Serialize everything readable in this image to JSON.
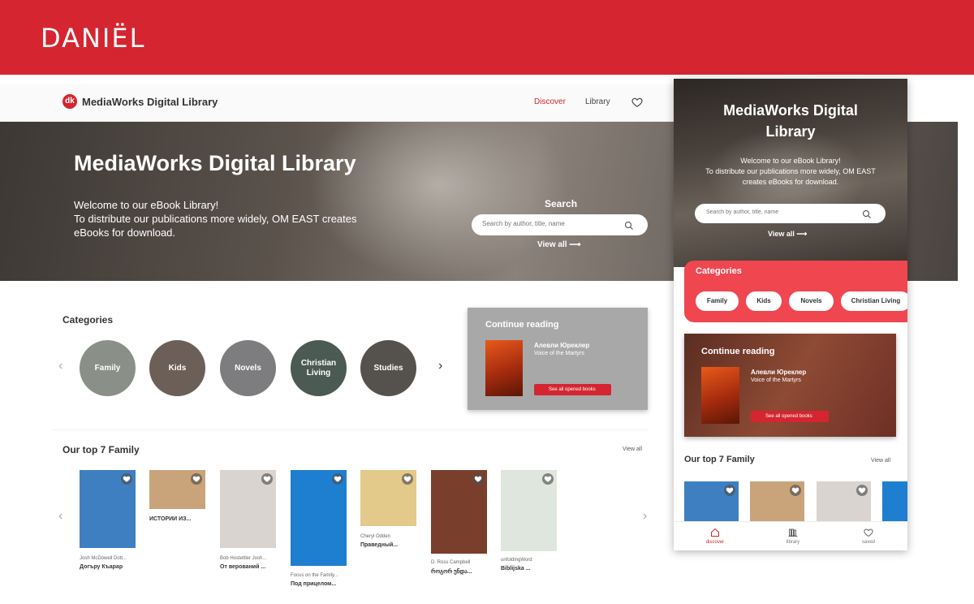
{
  "brand": {
    "name": "DANIËL"
  },
  "desktop": {
    "nav": {
      "logo_text": "MediaWorks Digital Library",
      "links": [
        {
          "label": "Discover",
          "active": true
        },
        {
          "label": "Library",
          "active": false
        }
      ]
    },
    "hero": {
      "title": "MediaWorks Digital Library",
      "line1": "Welcome to our eBook Library!",
      "line2": "To distribute our publications more widely, OM EAST creates eBooks for download.",
      "search_label": "Search",
      "search_placeholder": "Search by author, title, name",
      "view_all": "View all"
    },
    "categories": {
      "title": "Categories",
      "items": [
        {
          "label": "Family",
          "color": "#8a8f88"
        },
        {
          "label": "Kids",
          "color": "#6b5f58"
        },
        {
          "label": "Novels",
          "color": "#7d7d80"
        },
        {
          "label": "Christian Living",
          "color": "#4c5a54"
        },
        {
          "label": "Studies",
          "color": "#55524e"
        }
      ]
    },
    "continue_reading": {
      "title": "Continue reading",
      "book_title": "Алевли Юреклер",
      "book_subtitle": "Voice of the Martyrs",
      "button": "See all opened books"
    },
    "top": {
      "title": "Our top 7 Family",
      "view_all": "View all",
      "books": [
        {
          "authors": "Josh McDowell   Dott...",
          "title": "Догъру Къарар",
          "color": "#3e7fc2"
        },
        {
          "authors": "",
          "title": "ИСТОРИИ ИЗ...",
          "color": "#c9a37a"
        },
        {
          "authors": "Bob Hostettler   Josh...",
          "title": "От верований ...",
          "color": "#d9d4cf"
        },
        {
          "authors": "Focus on the Family...",
          "title": "Под прицелом...",
          "color": "#1e7fd0"
        },
        {
          "authors": "Cheryl Odden",
          "title": "Праведный...",
          "color": "#e3c98a"
        },
        {
          "authors": "D. Ross Campbell",
          "title": "როგორ უნდა...",
          "color": "#7a3f2c"
        },
        {
          "authors": "unfoldingWord",
          "title": "Biblijska ...",
          "color": "#dfe6dd"
        }
      ]
    }
  },
  "mobile": {
    "hero": {
      "title_line1": "MediaWorks Digital",
      "title_line2": "Library",
      "line1": "Welcome to our eBook Library!",
      "line2": "To distribute our publications more widely, OM EAST creates eBooks for download.",
      "search_placeholder": "Search by author, title, name",
      "view_all": "View all"
    },
    "categories": {
      "title": "Categories",
      "pills": [
        "Family",
        "Kids",
        "Novels",
        "Christian Living"
      ]
    },
    "continue_reading": {
      "title": "Continue reading",
      "book_title": "Алевли Юреклер",
      "book_subtitle": "Voice of the Martyrs",
      "button": "See all opened books"
    },
    "top": {
      "title": "Our top 7 Family",
      "view_all": "View all",
      "book_colors": [
        "#3e7fc2",
        "#c9a37a",
        "#d9d4cf",
        "#1e7fd0"
      ]
    },
    "tabs": [
      {
        "label": "discover",
        "icon": "home-icon",
        "active": true
      },
      {
        "label": "library",
        "icon": "books-icon",
        "active": false
      },
      {
        "label": "saved",
        "icon": "heart-icon",
        "active": false
      }
    ]
  },
  "colors": {
    "accent": "#d42530",
    "mobile_categories_bg": "#f04650"
  }
}
